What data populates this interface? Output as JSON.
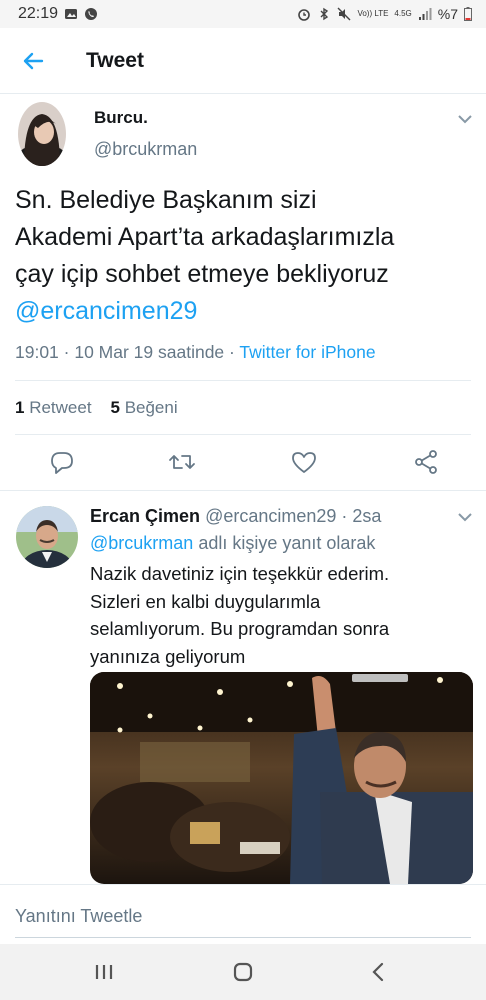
{
  "status_bar": {
    "time": "22:19",
    "lte_label": "Vo)) LTE",
    "net_speed": "4.5G",
    "battery": "%7"
  },
  "header": {
    "title": "Tweet"
  },
  "tweet": {
    "display_name": "Burcu.",
    "handle": "@brcukrman",
    "text_line_1": "Sn. Belediye Başkanım sizi",
    "text_line_2": "Akademi Apart’ta arkadaşlarımızla",
    "text_line_3": "çay içip sohbet etmeye bekliyoruz",
    "mention": "@ercancimen29",
    "timestamp": "19:01 · 10 Mar 19 saatinde · ",
    "source": "Twitter for iPhone",
    "retweet_count": "1",
    "retweet_label": "Retweet",
    "like_count": "5",
    "like_label": "Beğeni"
  },
  "reply": {
    "display_name": "Ercan Çimen",
    "handle_time": "@ercancimen29 · 2sa",
    "reply_to_handle": "@brcukrman",
    "reply_to_suffix": " adlı kişiye yanıt olarak",
    "text_line_1": "Nazik davetiniz için teşekkür ederim.",
    "text_line_2": "Sizleri en kalbi duygularımla",
    "text_line_3": "selamlıyorum. Bu programdan sonra",
    "text_line_4": "yanınıza geliyorum"
  },
  "composer": {
    "placeholder": "Yanıtını Tweetle"
  },
  "colors": {
    "accent": "#1da1f2",
    "secondary_text": "#657786",
    "primary_text": "#14171a"
  },
  "icons": [
    "back-arrow-icon",
    "chevron-down-icon",
    "reply-icon",
    "retweet-icon",
    "like-icon",
    "share-icon",
    "recents-icon",
    "home-icon",
    "back-nav-icon"
  ]
}
